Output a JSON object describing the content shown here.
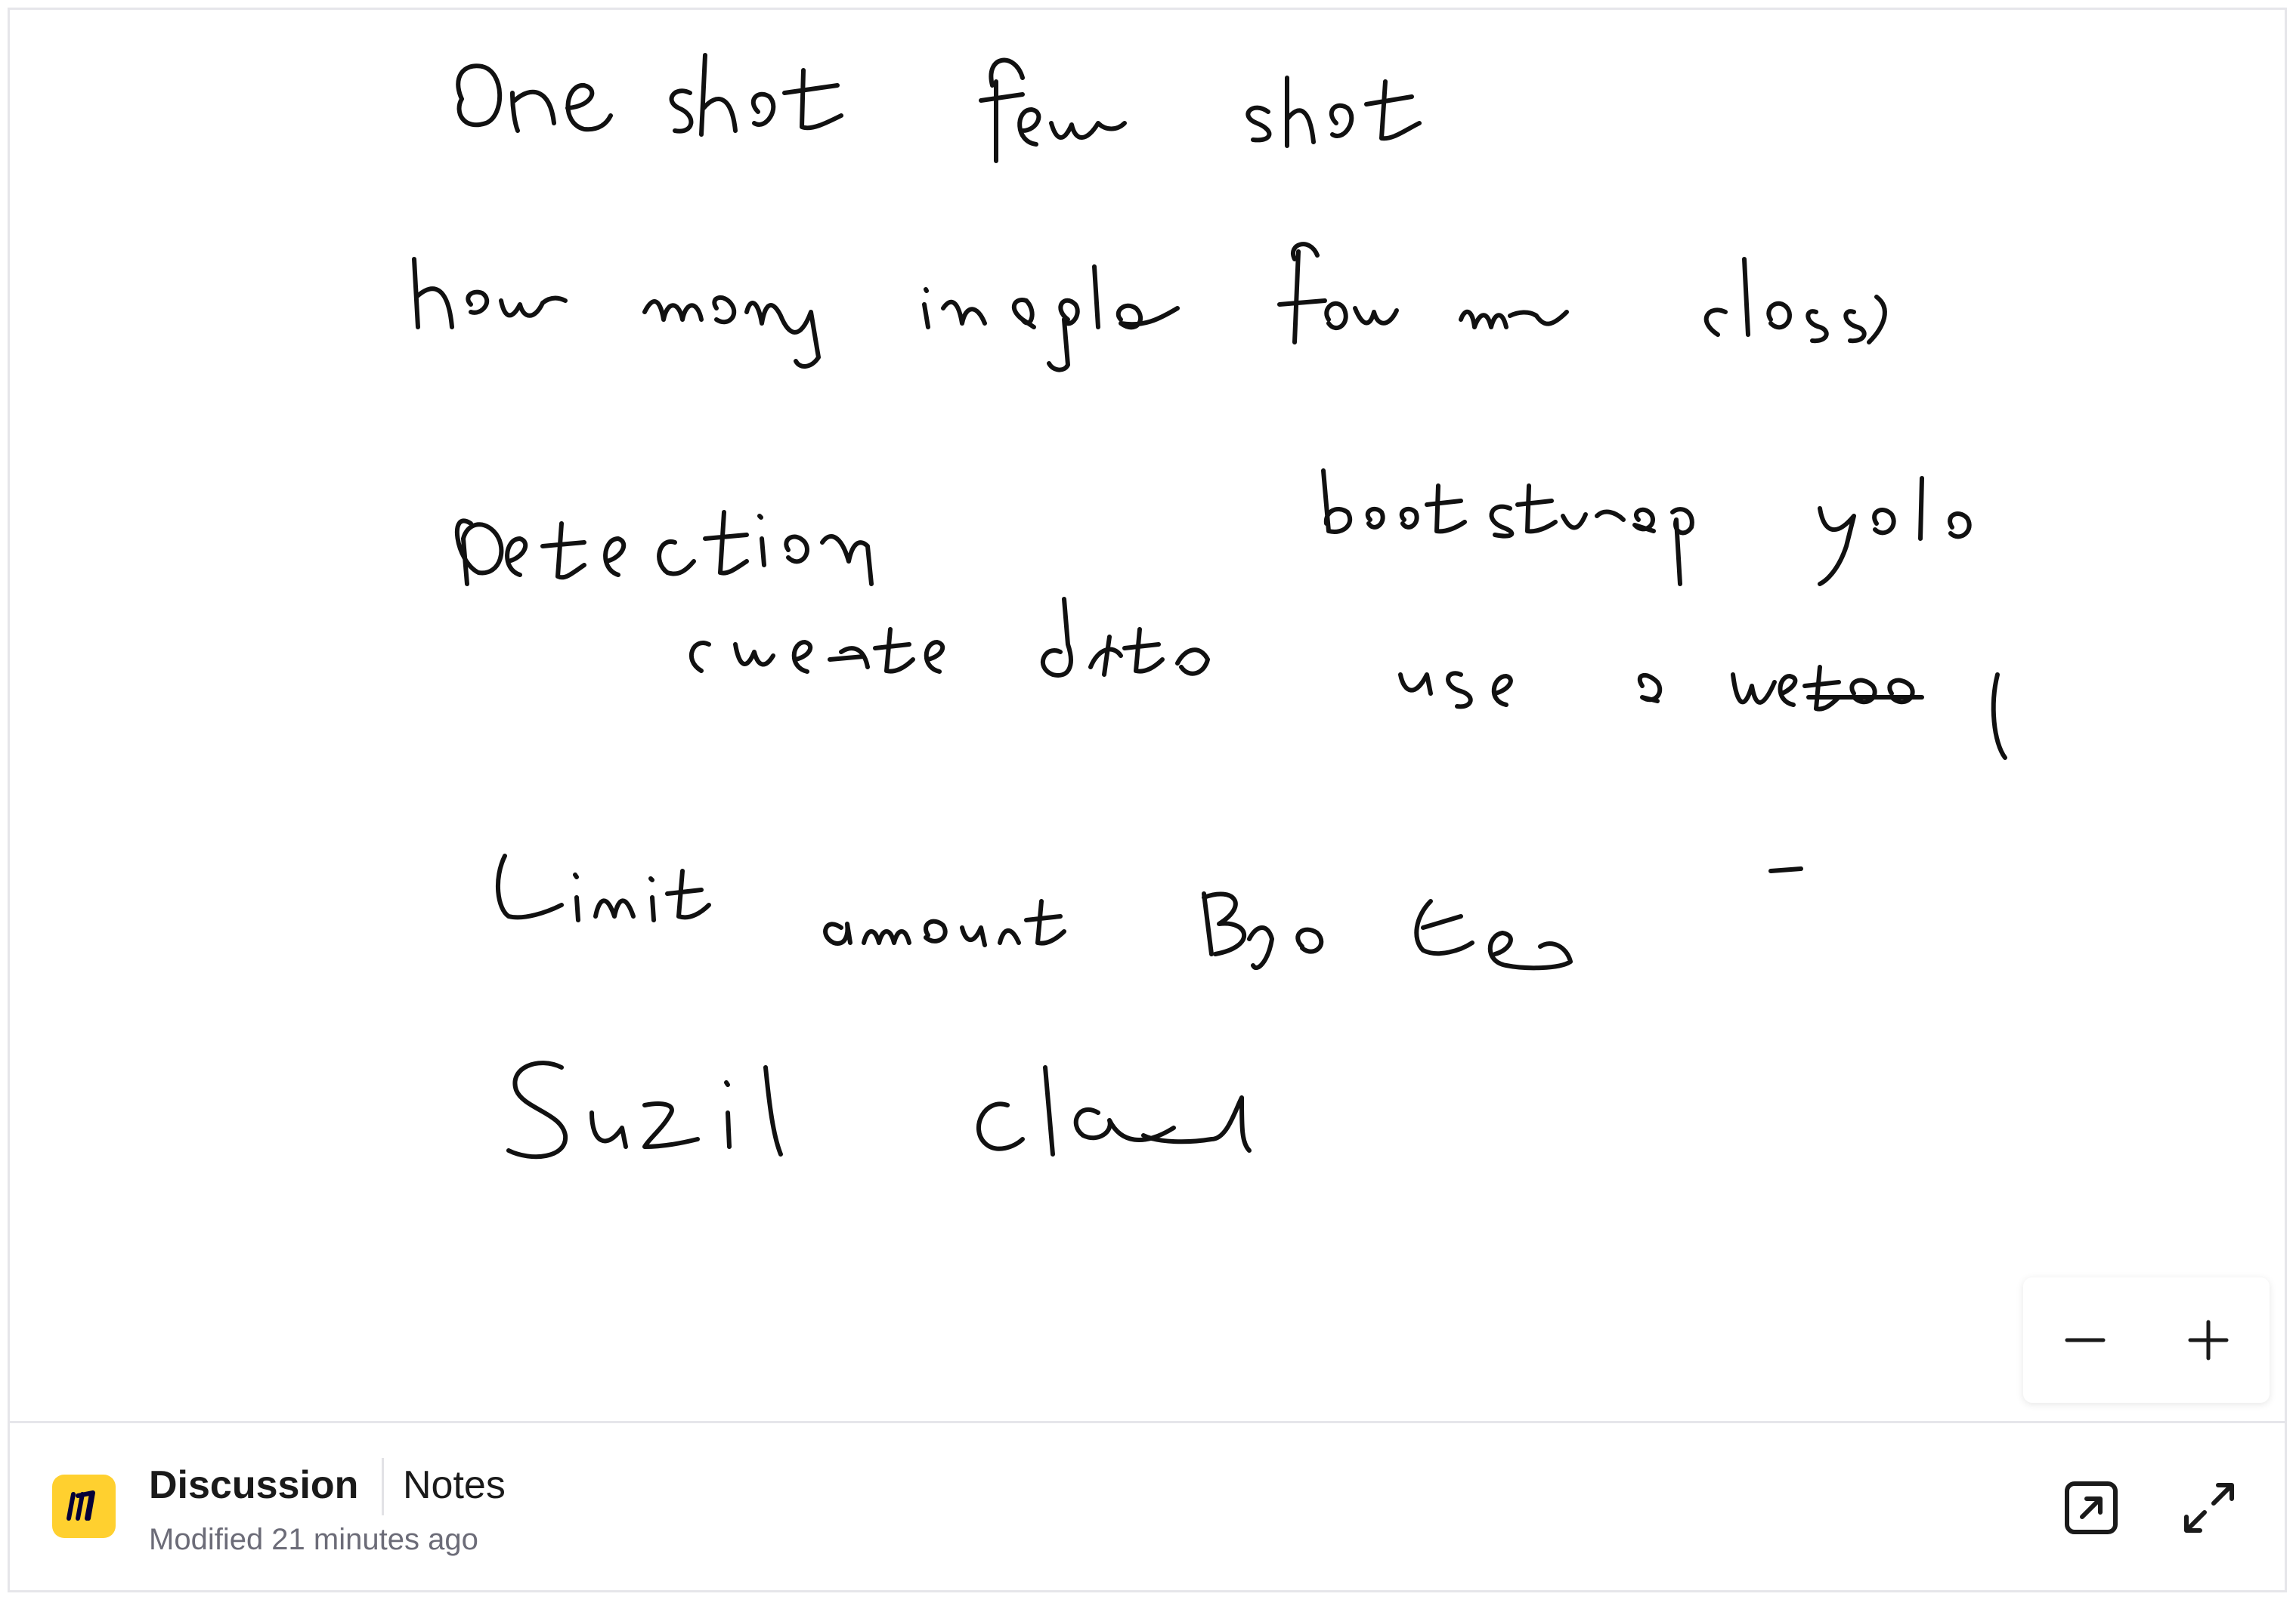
{
  "board": {
    "title": "Discussion",
    "tag": "Notes",
    "modified": "Modified 21 minutes ago"
  },
  "canvas": {
    "handwritten_notes": [
      "One shot few shot",
      "how many images for new class",
      "detection",
      "bootstrap yolo",
      "create data",
      "use a web tool",
      "Limit amount Boxes",
      "Small class"
    ]
  },
  "zoom": {
    "out_icon": "minus-icon",
    "in_icon": "plus-icon"
  },
  "actions": {
    "open_icon": "external-link-icon",
    "fullscreen_icon": "expand-icon"
  },
  "colors": {
    "ink": "#111111",
    "brand": "#ffd02f",
    "text_primary": "#1a1a1a",
    "text_secondary": "#6c6c78",
    "border": "#e6e6ea"
  }
}
